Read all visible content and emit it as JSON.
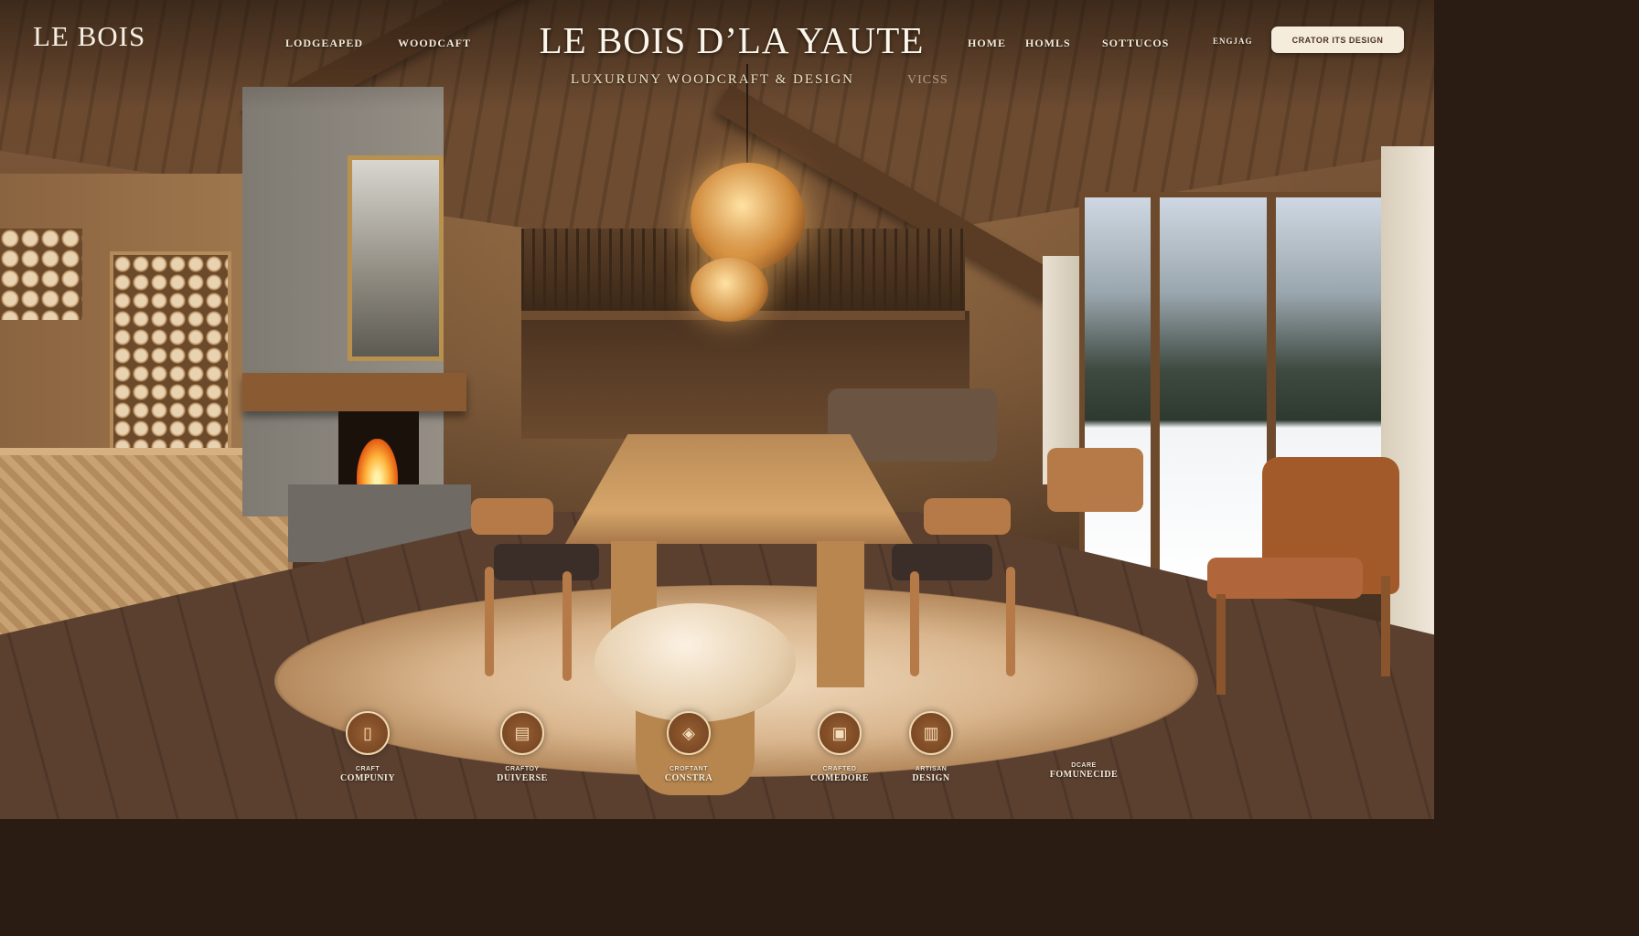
{
  "brand": {
    "logo": "LE BOIS"
  },
  "nav": {
    "left": [
      "LODGEAPED",
      "WOODCAFT"
    ],
    "right": [
      "HOME",
      "HOMLS",
      "SOTTUCOS",
      "ENGJAG"
    ]
  },
  "hero": {
    "title": "LE BOIS D’LA YAUTE",
    "tagline": "LUXURUNY WOODCRAFT & DESIGN",
    "tagline_secondary": "VICSS",
    "cta_label": "CRATOR ITS DESIGN"
  },
  "features": [
    {
      "icon": "door-icon",
      "glyph": "▯",
      "caption_top": "CRAFT",
      "caption_bottom": "COMPUNIY"
    },
    {
      "icon": "boards-icon",
      "glyph": "▤",
      "caption_top": "CRAFTOY",
      "caption_bottom": "DUIVERSE"
    },
    {
      "icon": "emblem-icon",
      "glyph": "◈",
      "caption_top": "CROFTANT",
      "caption_bottom": "CONSTRA"
    },
    {
      "icon": "frame-icon",
      "glyph": "▣",
      "caption_top": "CRAFTED",
      "caption_bottom": "COMEDORE"
    },
    {
      "icon": "cabinet-icon",
      "glyph": "▥",
      "caption_top": "ARTISAN",
      "caption_bottom": "DESIGN"
    },
    {
      "icon": "plan-icon",
      "glyph": "",
      "caption_top": "DCARE",
      "caption_bottom": "FOMUNECIDE"
    }
  ],
  "colors": {
    "accent": "#f6ecdc",
    "wood": "#b98650",
    "text": "#f7efe3"
  }
}
